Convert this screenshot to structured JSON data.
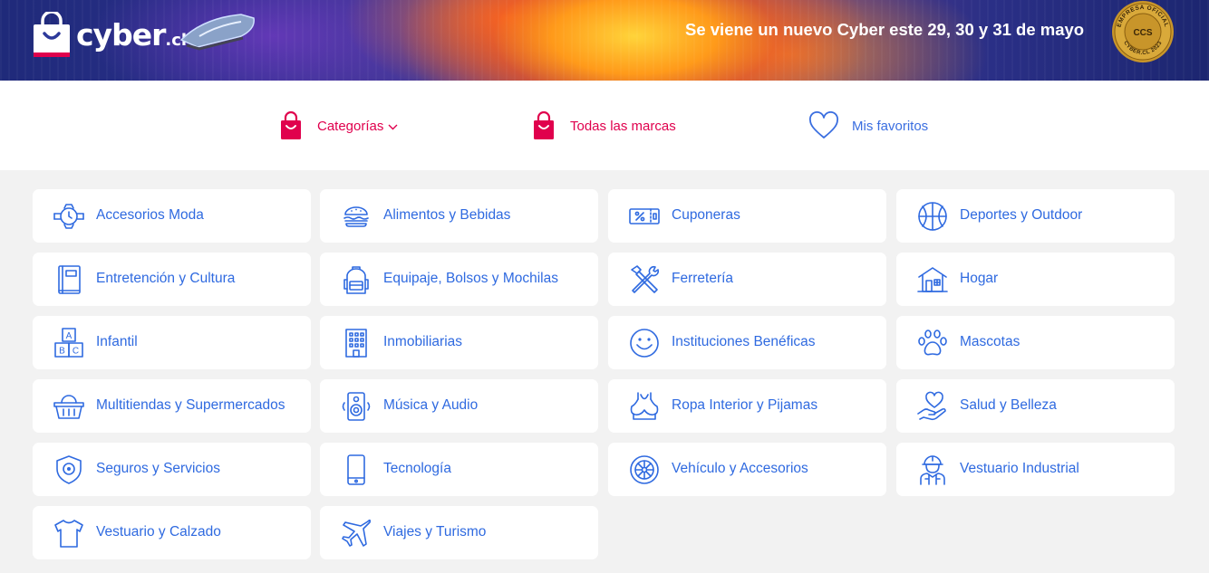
{
  "banner": {
    "logo_text": "cyber",
    "logo_suffix": ".cl",
    "promo_text": "Se viene un nuevo Cyber este 29, 30 y 31 de mayo",
    "seal": {
      "top": "EMPRESA OFICIAL",
      "center": "CCS",
      "bottom": "CYBER.CL 2023"
    }
  },
  "nav": {
    "categories_label": "Categorías",
    "brands_label": "Todas las marcas",
    "favorites_label": "Mis favoritos"
  },
  "colors": {
    "accent_blue": "#2f6ae0",
    "brand_pink": "#e0004d",
    "background": "#f2f2f2"
  },
  "categories": [
    {
      "label": "Accesorios Moda",
      "icon": "watch-icon"
    },
    {
      "label": "Alimentos y Bebidas",
      "icon": "burger-icon"
    },
    {
      "label": "Cuponeras",
      "icon": "coupon-icon"
    },
    {
      "label": "Deportes y Outdoor",
      "icon": "basketball-icon"
    },
    {
      "label": "Entretención y Cultura",
      "icon": "book-icon"
    },
    {
      "label": "Equipaje, Bolsos y Mochilas",
      "icon": "backpack-icon"
    },
    {
      "label": "Ferretería",
      "icon": "tools-icon"
    },
    {
      "label": "Hogar",
      "icon": "house-icon"
    },
    {
      "label": "Infantil",
      "icon": "abc-blocks-icon"
    },
    {
      "label": "Inmobiliarias",
      "icon": "building-icon"
    },
    {
      "label": "Instituciones Benéficas",
      "icon": "smiley-icon"
    },
    {
      "label": "Mascotas",
      "icon": "paw-icon"
    },
    {
      "label": "Multitiendas y Supermercados",
      "icon": "basket-icon"
    },
    {
      "label": "Música y Audio",
      "icon": "speaker-icon"
    },
    {
      "label": "Ropa Interior y Pijamas",
      "icon": "lingerie-icon"
    },
    {
      "label": "Salud y Belleza",
      "icon": "heart-hand-icon"
    },
    {
      "label": "Seguros y Servicios",
      "icon": "shield-icon"
    },
    {
      "label": "Tecnología",
      "icon": "smartphone-icon"
    },
    {
      "label": "Vehículo y Accesorios",
      "icon": "wheel-icon"
    },
    {
      "label": "Vestuario Industrial",
      "icon": "worker-icon"
    },
    {
      "label": "Vestuario y Calzado",
      "icon": "tshirt-icon"
    },
    {
      "label": "Viajes y Turismo",
      "icon": "airplane-icon"
    }
  ]
}
